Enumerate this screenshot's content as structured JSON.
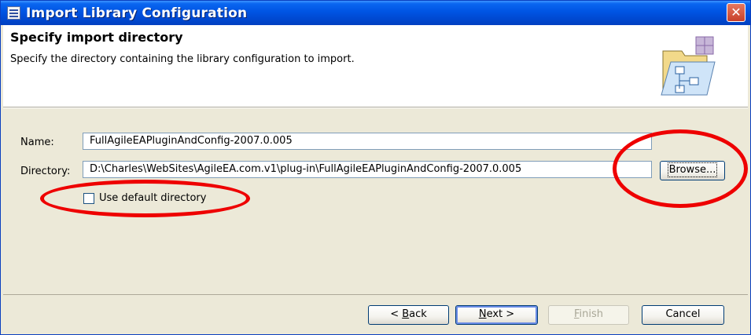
{
  "window": {
    "title": "Import Library Configuration"
  },
  "banner": {
    "title": "Specify import directory",
    "description": "Specify the directory containing the library configuration to import."
  },
  "form": {
    "name_label": "Name:",
    "name_value": "FullAgileEAPluginAndConfig-2007.0.005",
    "directory_label": "Directory:",
    "directory_value": "D:\\Charles\\WebSites\\AgileEA.com.v1\\plug-in\\FullAgileEAPluginAndConfig-2007.0.005",
    "browse_label": "Browse...",
    "use_default_label": "Use default directory",
    "use_default_checked": false
  },
  "buttons": {
    "back": {
      "prefix": "< ",
      "mnemonic": "B",
      "rest": "ack"
    },
    "next": {
      "mnemonic": "N",
      "rest": "ext >"
    },
    "finish": {
      "mnemonic": "F",
      "rest": "inish"
    },
    "cancel": "Cancel"
  },
  "annotations": {
    "color": "#ee0000"
  },
  "colors": {
    "titlebar": "#0054e3",
    "dialog_bg": "#ece9d8",
    "banner_bg": "#ffffff"
  }
}
